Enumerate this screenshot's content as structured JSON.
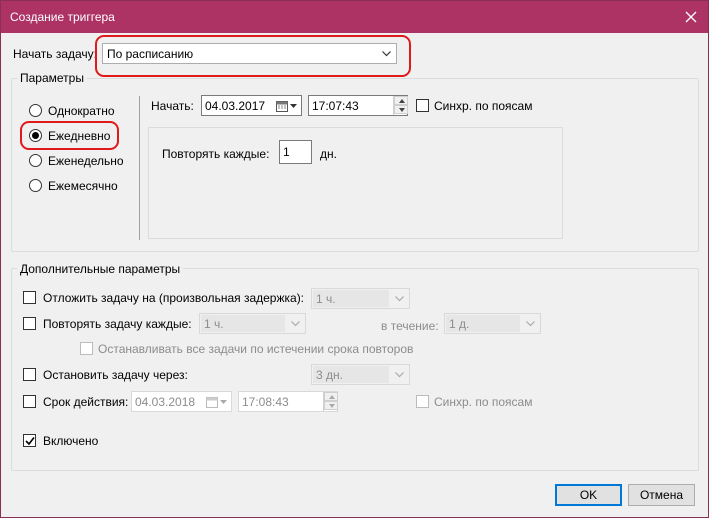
{
  "window": {
    "title": "Создание триггера"
  },
  "begin_task": {
    "label": "Начать задачу:",
    "value": "По расписанию"
  },
  "params": {
    "legend": "Параметры",
    "schedule_options": [
      "Однократно",
      "Ежедневно",
      "Еженедельно",
      "Ежемесячно"
    ],
    "selected": "Ежедневно",
    "start_label": "Начать:",
    "start_date": "04.03.2017",
    "start_time": "17:07:43",
    "sync_label": "Синхр. по поясам",
    "repeat_every_label": "Повторять каждые:",
    "repeat_every_value": "1",
    "repeat_every_unit": "дн."
  },
  "advanced": {
    "legend": "Дополнительные параметры",
    "delay": {
      "label": "Отложить задачу на (произвольная задержка):",
      "value": "1 ч."
    },
    "repeat": {
      "label": "Повторять задачу каждые:",
      "value": "1 ч.",
      "duration_label": "в течение:",
      "duration_value": "1 д."
    },
    "stop_all_label": "Останавливать все задачи по истечении срока повторов",
    "stop_after": {
      "label": "Остановить задачу через:",
      "value": "3 дн."
    },
    "expire": {
      "label": "Срок действия:",
      "date": "04.03.2018",
      "time": "17:08:43",
      "sync_label": "Синхр. по поясам"
    },
    "enabled": {
      "label": "Включено",
      "checked": true
    }
  },
  "buttons": {
    "ok": "OK",
    "cancel": "Отмена"
  },
  "colors": {
    "titlebar": "#ac3364",
    "highlight": "#e01a1a",
    "default_button_border": "#0078d7"
  }
}
